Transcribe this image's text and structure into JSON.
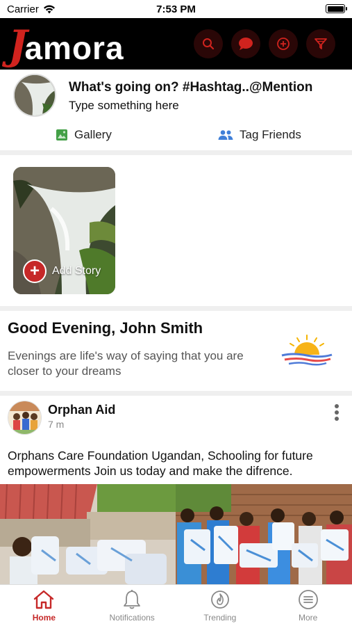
{
  "status_bar": {
    "carrier": "Carrier",
    "time": "7:53 PM"
  },
  "header": {
    "logo_initial": "J",
    "logo_rest": "amora",
    "icons": [
      "search-icon",
      "chat-icon",
      "add-circle-icon",
      "filter-icon"
    ],
    "accent_color": "#d0231e"
  },
  "composer": {
    "title": "What's going on? #Hashtag..@Mention",
    "placeholder": "Type something here",
    "gallery_label": "Gallery",
    "tag_friends_label": "Tag Friends"
  },
  "stories": {
    "add_story_label": "Add Story"
  },
  "greeting": {
    "title": "Good Evening, John Smith",
    "message": "Evenings are life's way of saying that you are closer to your dreams"
  },
  "post": {
    "author": "Orphan Aid",
    "time": "7 m",
    "text": "Orphans Care Foundation Ugandan, Schooling for future empowerments Join us today and make the difrence."
  },
  "tabbar": {
    "items": [
      {
        "label": "Home",
        "icon": "home-icon",
        "active": true
      },
      {
        "label": "Notifications",
        "icon": "bell-icon",
        "active": false
      },
      {
        "label": "Trending",
        "icon": "flame-icon",
        "active": false
      },
      {
        "label": "More",
        "icon": "menu-icon",
        "active": false
      }
    ]
  }
}
